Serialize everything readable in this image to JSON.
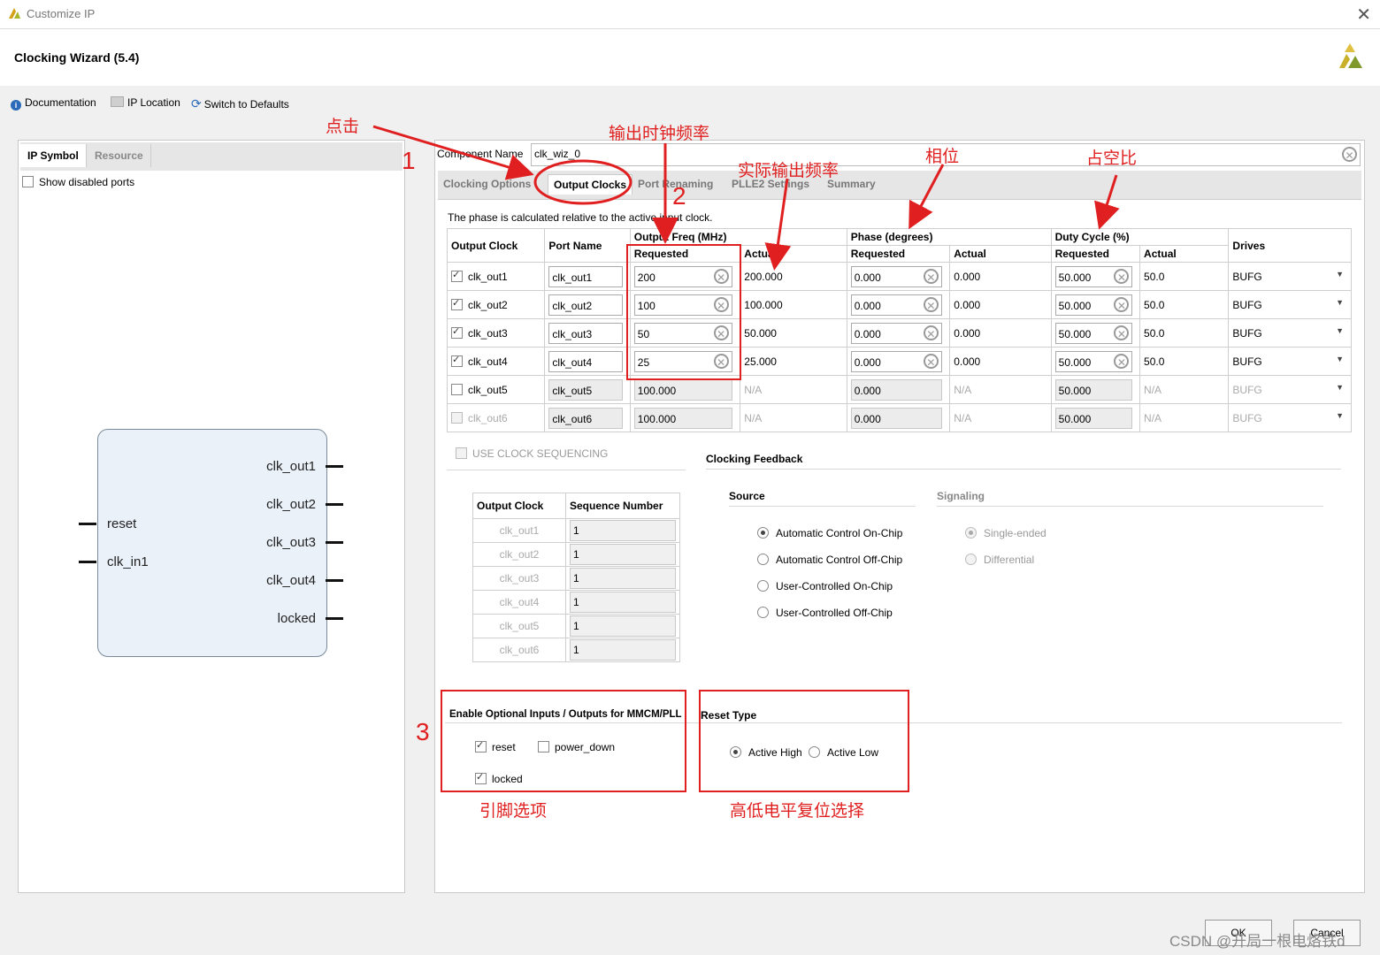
{
  "window": {
    "title": "Customize IP",
    "close": "✕"
  },
  "header": {
    "title": "Clocking Wizard (5.4)"
  },
  "toolbar": {
    "documentation": "Documentation",
    "ip_location": "IP Location",
    "switch_defaults": "Switch to Defaults"
  },
  "left_panel": {
    "tabs": [
      "IP Symbol",
      "Resource"
    ],
    "show_disabled_ports": "Show disabled ports",
    "symbol": {
      "inputs": [
        "reset",
        "clk_in1"
      ],
      "outputs": [
        "clk_out1",
        "clk_out2",
        "clk_out3",
        "clk_out4",
        "locked"
      ]
    }
  },
  "right_panel": {
    "component_name_label": "Component Name",
    "component_name_value": "clk_wiz_0",
    "tabs": [
      "Clocking Options",
      "Output Clocks",
      "Port Renaming",
      "PLLE2 Settings",
      "Summary"
    ],
    "phase_note": "The phase is calculated relative to the active input clock.",
    "table_headers": {
      "output_clock": "Output Clock",
      "port_name": "Port Name",
      "output_freq": "Output Freq (MHz)",
      "phase": "Phase (degrees)",
      "duty": "Duty Cycle (%)",
      "drives": "Drives",
      "requested": "Requested",
      "actual": "Actual"
    },
    "rows": [
      {
        "name": "clk_out1",
        "port": "clk_out1",
        "freq_req": "200",
        "freq_act": "200.000",
        "phase_req": "0.000",
        "phase_act": "0.000",
        "duty_req": "50.000",
        "duty_act": "50.0",
        "drives": "BUFG"
      },
      {
        "name": "clk_out2",
        "port": "clk_out2",
        "freq_req": "100",
        "freq_act": "100.000",
        "phase_req": "0.000",
        "phase_act": "0.000",
        "duty_req": "50.000",
        "duty_act": "50.0",
        "drives": "BUFG"
      },
      {
        "name": "clk_out3",
        "port": "clk_out3",
        "freq_req": "50",
        "freq_act": "50.000",
        "phase_req": "0.000",
        "phase_act": "0.000",
        "duty_req": "50.000",
        "duty_act": "50.0",
        "drives": "BUFG"
      },
      {
        "name": "clk_out4",
        "port": "clk_out4",
        "freq_req": "25",
        "freq_act": "25.000",
        "phase_req": "0.000",
        "phase_act": "0.000",
        "duty_req": "50.000",
        "duty_act": "50.0",
        "drives": "BUFG"
      },
      {
        "name": "clk_out5",
        "port": "clk_out5",
        "freq_req": "100.000",
        "freq_act": "N/A",
        "phase_req": "0.000",
        "phase_act": "N/A",
        "duty_req": "50.000",
        "duty_act": "N/A",
        "drives": "BUFG"
      },
      {
        "name": "clk_out6",
        "port": "clk_out6",
        "freq_req": "100.000",
        "freq_act": "N/A",
        "phase_req": "0.000",
        "phase_act": "N/A",
        "duty_req": "50.000",
        "duty_act": "N/A",
        "drives": "BUFG"
      }
    ],
    "use_clock_sequencing": "USE CLOCK SEQUENCING",
    "sequence": {
      "headers": [
        "Output Clock",
        "Sequence Number"
      ],
      "rows": [
        {
          "clock": "clk_out1",
          "num": "1"
        },
        {
          "clock": "clk_out2",
          "num": "1"
        },
        {
          "clock": "clk_out3",
          "num": "1"
        },
        {
          "clock": "clk_out4",
          "num": "1"
        },
        {
          "clock": "clk_out5",
          "num": "1"
        },
        {
          "clock": "clk_out6",
          "num": "1"
        }
      ]
    },
    "clocking_feedback": {
      "title": "Clocking Feedback",
      "source_title": "Source",
      "signaling_title": "Signaling",
      "source_options": [
        "Automatic Control On-Chip",
        "Automatic Control Off-Chip",
        "User-Controlled On-Chip",
        "User-Controlled Off-Chip"
      ],
      "signaling_options": [
        "Single-ended",
        "Differential"
      ]
    },
    "optional_io": {
      "title": "Enable Optional Inputs / Outputs for MMCM/PLL",
      "reset": "reset",
      "power_down": "power_down",
      "locked": "locked"
    },
    "reset_type": {
      "title": "Reset Type",
      "high": "Active High",
      "low": "Active Low"
    }
  },
  "buttons": {
    "ok": "OK",
    "cancel": "Cancel"
  },
  "annotations": {
    "click": "点击",
    "output_freq": "输出时钟频率",
    "actual_freq": "实际输出频率",
    "phase": "相位",
    "duty": "占空比",
    "pins": "引脚选项",
    "reset_level": "高低电平复位选择",
    "n1": "1",
    "n2": "2",
    "n3": "3"
  },
  "watermark": "CSDN @开局一根电烙铁d",
  "colors": {
    "annotation": "#e02020",
    "symbol_fill": "#eaf1f9",
    "accent": "#2a6ab8"
  }
}
